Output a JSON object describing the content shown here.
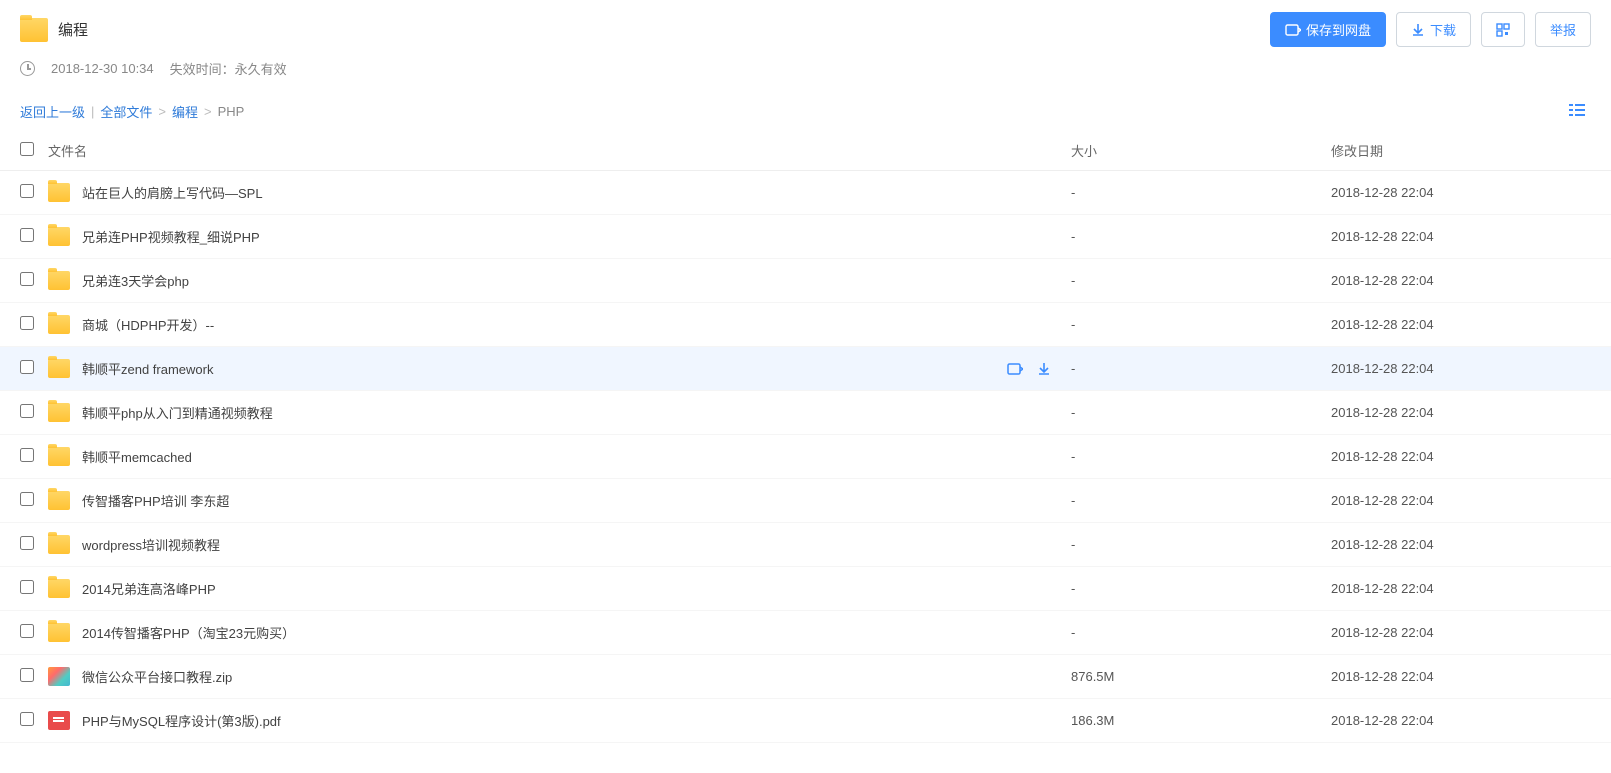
{
  "header": {
    "title": "编程",
    "save_label": "保存到网盘",
    "download_label": "下载",
    "report_label": "举报"
  },
  "meta": {
    "timestamp": "2018-12-30 10:34",
    "expire_label": "失效时间：永久有效"
  },
  "breadcrumb": {
    "back": "返回上一级",
    "root": "全部文件",
    "folder": "编程",
    "current": "PHP"
  },
  "columns": {
    "name": "文件名",
    "size": "大小",
    "date": "修改日期"
  },
  "files": [
    {
      "type": "folder",
      "name": "站在巨人的肩膀上写代码—SPL",
      "size": "-",
      "date": "2018-12-28 22:04",
      "hovered": false
    },
    {
      "type": "folder",
      "name": "兄弟连PHP视频教程_细说PHP",
      "size": "-",
      "date": "2018-12-28 22:04",
      "hovered": false
    },
    {
      "type": "folder",
      "name": "兄弟连3天学会php",
      "size": "-",
      "date": "2018-12-28 22:04",
      "hovered": false
    },
    {
      "type": "folder",
      "name": "商城（HDPHP开发）--",
      "size": "-",
      "date": "2018-12-28 22:04",
      "hovered": false
    },
    {
      "type": "folder",
      "name": "韩顺平zend framework",
      "size": "-",
      "date": "2018-12-28 22:04",
      "hovered": true
    },
    {
      "type": "folder",
      "name": "韩顺平php从入门到精通视频教程",
      "size": "-",
      "date": "2018-12-28 22:04",
      "hovered": false
    },
    {
      "type": "folder",
      "name": "韩顺平memcached",
      "size": "-",
      "date": "2018-12-28 22:04",
      "hovered": false
    },
    {
      "type": "folder",
      "name": "传智播客PHP培训 李东超",
      "size": "-",
      "date": "2018-12-28 22:04",
      "hovered": false
    },
    {
      "type": "folder",
      "name": "wordpress培训视频教程",
      "size": "-",
      "date": "2018-12-28 22:04",
      "hovered": false
    },
    {
      "type": "folder",
      "name": "2014兄弟连高洛峰PHP",
      "size": "-",
      "date": "2018-12-28 22:04",
      "hovered": false
    },
    {
      "type": "folder",
      "name": "2014传智播客PHP（淘宝23元购买）",
      "size": "-",
      "date": "2018-12-28 22:04",
      "hovered": false
    },
    {
      "type": "zip",
      "name": "微信公众平台接口教程.zip",
      "size": "876.5M",
      "date": "2018-12-28 22:04",
      "hovered": false
    },
    {
      "type": "pdf",
      "name": "PHP与MySQL程序设计(第3版).pdf",
      "size": "186.3M",
      "date": "2018-12-28 22:04",
      "hovered": false
    }
  ]
}
